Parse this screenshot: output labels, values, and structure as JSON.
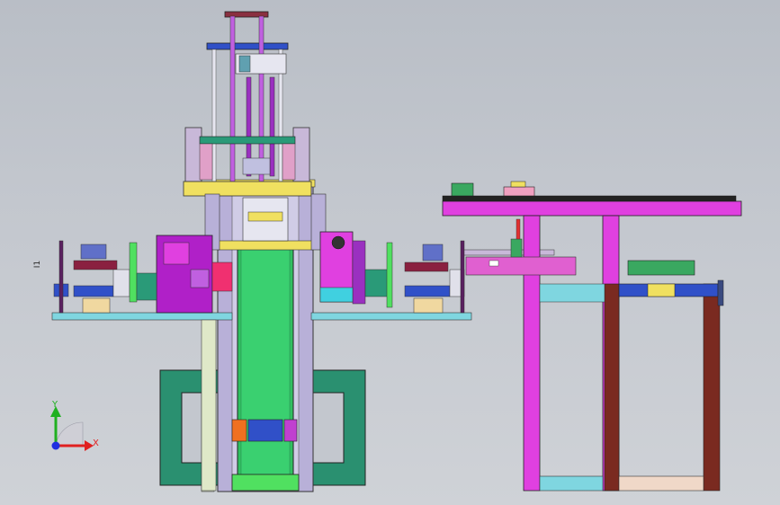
{
  "triad": {
    "x_label": "X",
    "y_label": "Y",
    "x_color": "#e02020",
    "y_color": "#20b020",
    "z_color": "#2030e0"
  },
  "side_tag": "I1",
  "colors": {
    "background": "#c3c7ce",
    "magenta": "#e040e0",
    "purple": "#9a30c0",
    "green": "#3aa860",
    "teal": "#2a9a78",
    "cyan": "#7fd6e0",
    "yellow": "#f0e060",
    "brown": "#7a2a20",
    "blue": "#3050c8",
    "lavender": "#b8b0d8"
  }
}
